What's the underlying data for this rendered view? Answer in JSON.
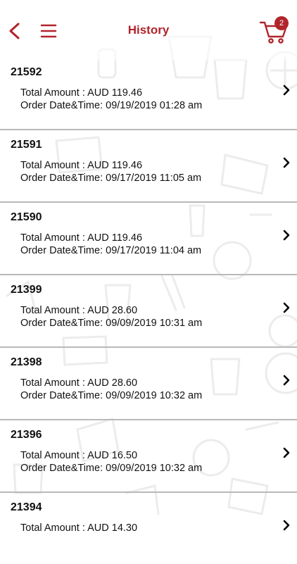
{
  "header": {
    "title": "History",
    "cart_count": "2"
  },
  "orders": [
    {
      "id": "21592",
      "amount_text": "Total Amount : AUD 119.46",
      "date_text": "Order Date&Time: 09/19/2019 01:28 am"
    },
    {
      "id": "21591",
      "amount_text": "Total Amount : AUD 119.46",
      "date_text": "Order Date&Time: 09/17/2019 11:05 am"
    },
    {
      "id": "21590",
      "amount_text": "Total Amount : AUD 119.46",
      "date_text": "Order Date&Time: 09/17/2019 11:04 am"
    },
    {
      "id": "21399",
      "amount_text": "Total Amount : AUD 28.60",
      "date_text": "Order Date&Time: 09/09/2019 10:31 am"
    },
    {
      "id": "21398",
      "amount_text": "Total Amount : AUD 28.60",
      "date_text": "Order Date&Time: 09/09/2019 10:32 am"
    },
    {
      "id": "21396",
      "amount_text": "Total Amount : AUD 16.50",
      "date_text": "Order Date&Time: 09/09/2019 10:32 am"
    },
    {
      "id": "21394",
      "amount_text": "Total Amount : AUD 14.30",
      "date_text": ""
    }
  ],
  "colors": {
    "accent": "#b0252b",
    "divider": "#b9b9b9",
    "pattern": "#ececec"
  },
  "icons": {
    "back": "back-chevron-icon",
    "menu": "hamburger-menu-icon",
    "cart": "shopping-cart-icon",
    "row": "chevron-right-icon"
  }
}
